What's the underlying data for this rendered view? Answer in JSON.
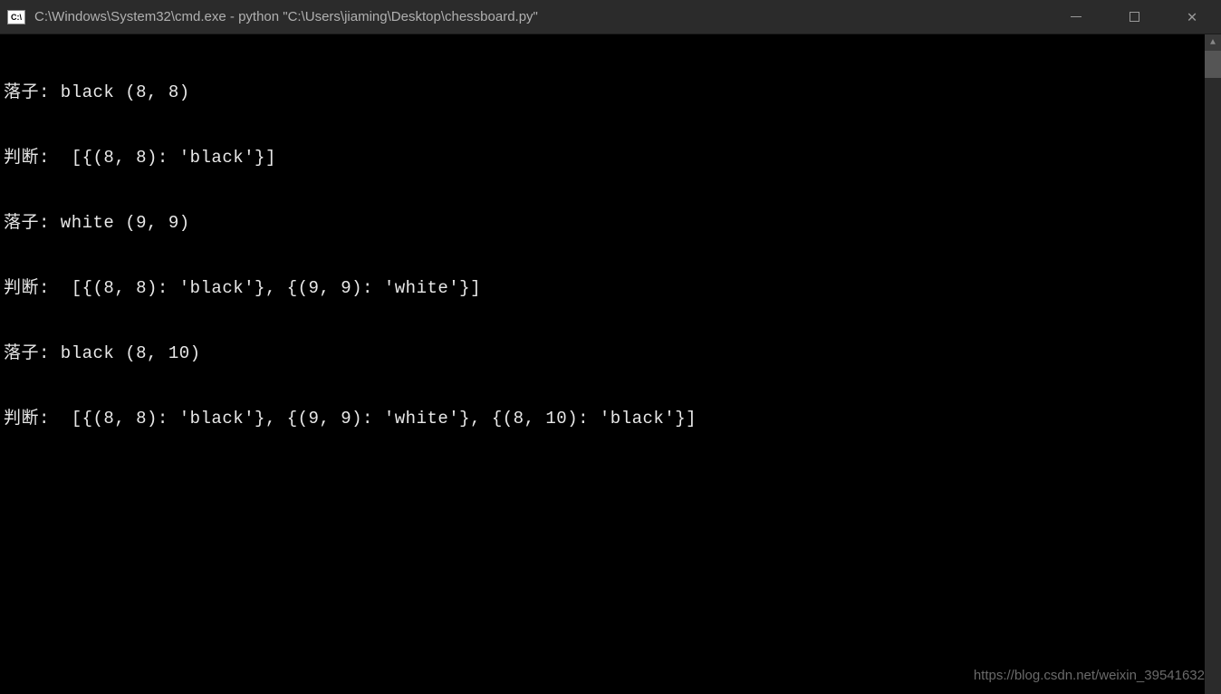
{
  "titlebar": {
    "icon_label": "C:\\",
    "title": "C:\\Windows\\System32\\cmd.exe - python  \"C:\\Users\\jiaming\\Desktop\\chessboard.py\""
  },
  "terminal": {
    "lines": [
      "落子: black (8, 8)",
      "判断:  [{(8, 8): 'black'}]",
      "落子: white (9, 9)",
      "判断:  [{(8, 8): 'black'}, {(9, 9): 'white'}]",
      "落子: black (8, 10)",
      "判断:  [{(8, 8): 'black'}, {(9, 9): 'white'}, {(8, 10): 'black'}]"
    ]
  },
  "watermark": "https://blog.csdn.net/weixin_39541632"
}
